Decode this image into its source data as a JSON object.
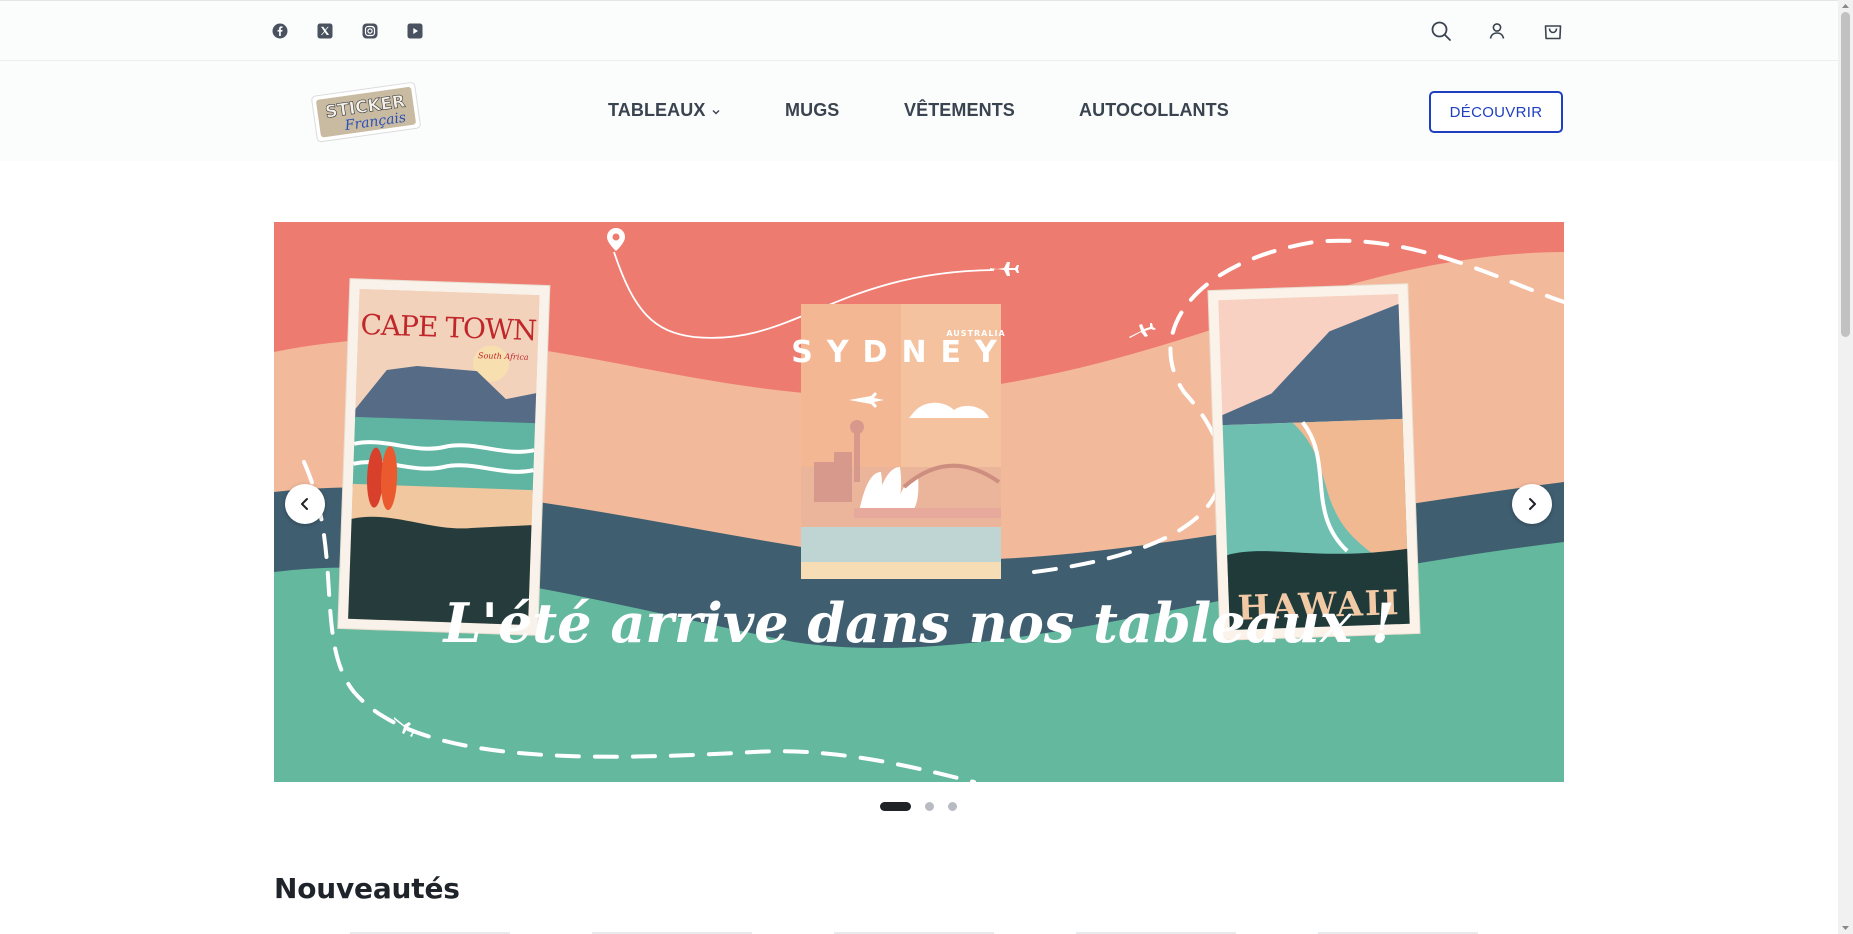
{
  "social": [
    {
      "name": "facebook-icon"
    },
    {
      "name": "x-twitter-icon"
    },
    {
      "name": "instagram-icon"
    },
    {
      "name": "youtube-icon"
    }
  ],
  "header": {
    "logo_text_top": "STICKER",
    "logo_text_bottom": "Français",
    "nav": [
      {
        "label": "TABLEAUX",
        "has_dropdown": true
      },
      {
        "label": "MUGS"
      },
      {
        "label": "VÊTEMENTS"
      },
      {
        "label": "AUTOCOLLANTS"
      }
    ],
    "cta_label": "DÉCOUVRIR",
    "accent_color": "#1f3fbf"
  },
  "slider": {
    "slide_count": 3,
    "active_index": 0,
    "posters": [
      {
        "title": "CAPE TOWN",
        "subtitle": "South Africa"
      },
      {
        "title": "SYDNEY",
        "subtitle": "AUSTRALIA"
      },
      {
        "title": "HAWAII"
      }
    ],
    "tagline": "L'été arrive dans nos tableaux !",
    "colors": {
      "coral": "#ee7b6f",
      "peach": "#f3b99b",
      "navy": "#3f5e70",
      "teal": "#63b89e"
    }
  },
  "sections": {
    "new_title": "Nouveautés"
  }
}
